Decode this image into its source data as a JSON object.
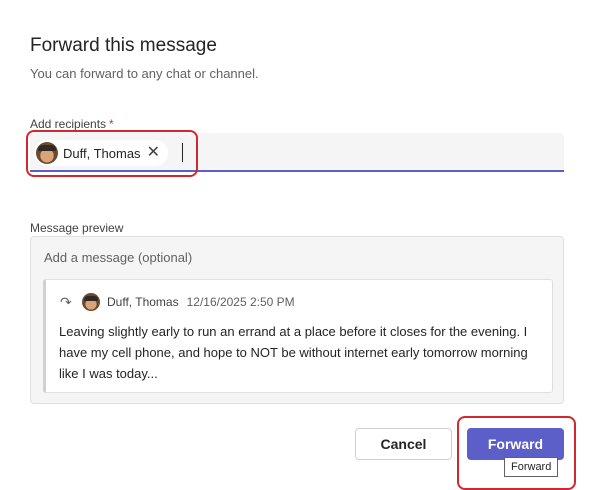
{
  "dialog": {
    "title": "Forward this message",
    "subtitle": "You can forward to any chat or channel."
  },
  "recipients": {
    "label": "Add recipients",
    "required_marker": "*",
    "chips": [
      {
        "name": "Duff, Thomas",
        "remove_icon": "close-icon"
      }
    ]
  },
  "preview": {
    "label": "Message preview",
    "message_placeholder": "Add a message (optional)",
    "quoted": {
      "icon": "forward-arrow-icon",
      "author": "Duff, Thomas",
      "timestamp": "12/16/2025 2:50 PM",
      "body": "Leaving slightly early to run an errand at a place before it closes for the evening. I have my cell phone, and hope to NOT be without internet early tomorrow morning like I was today..."
    }
  },
  "actions": {
    "cancel_label": "Cancel",
    "forward_label": "Forward",
    "forward_tooltip": "Forward"
  },
  "colors": {
    "accent": "#5b5fc7",
    "highlight_outline": "#d0282e",
    "required": "#c4314b"
  }
}
